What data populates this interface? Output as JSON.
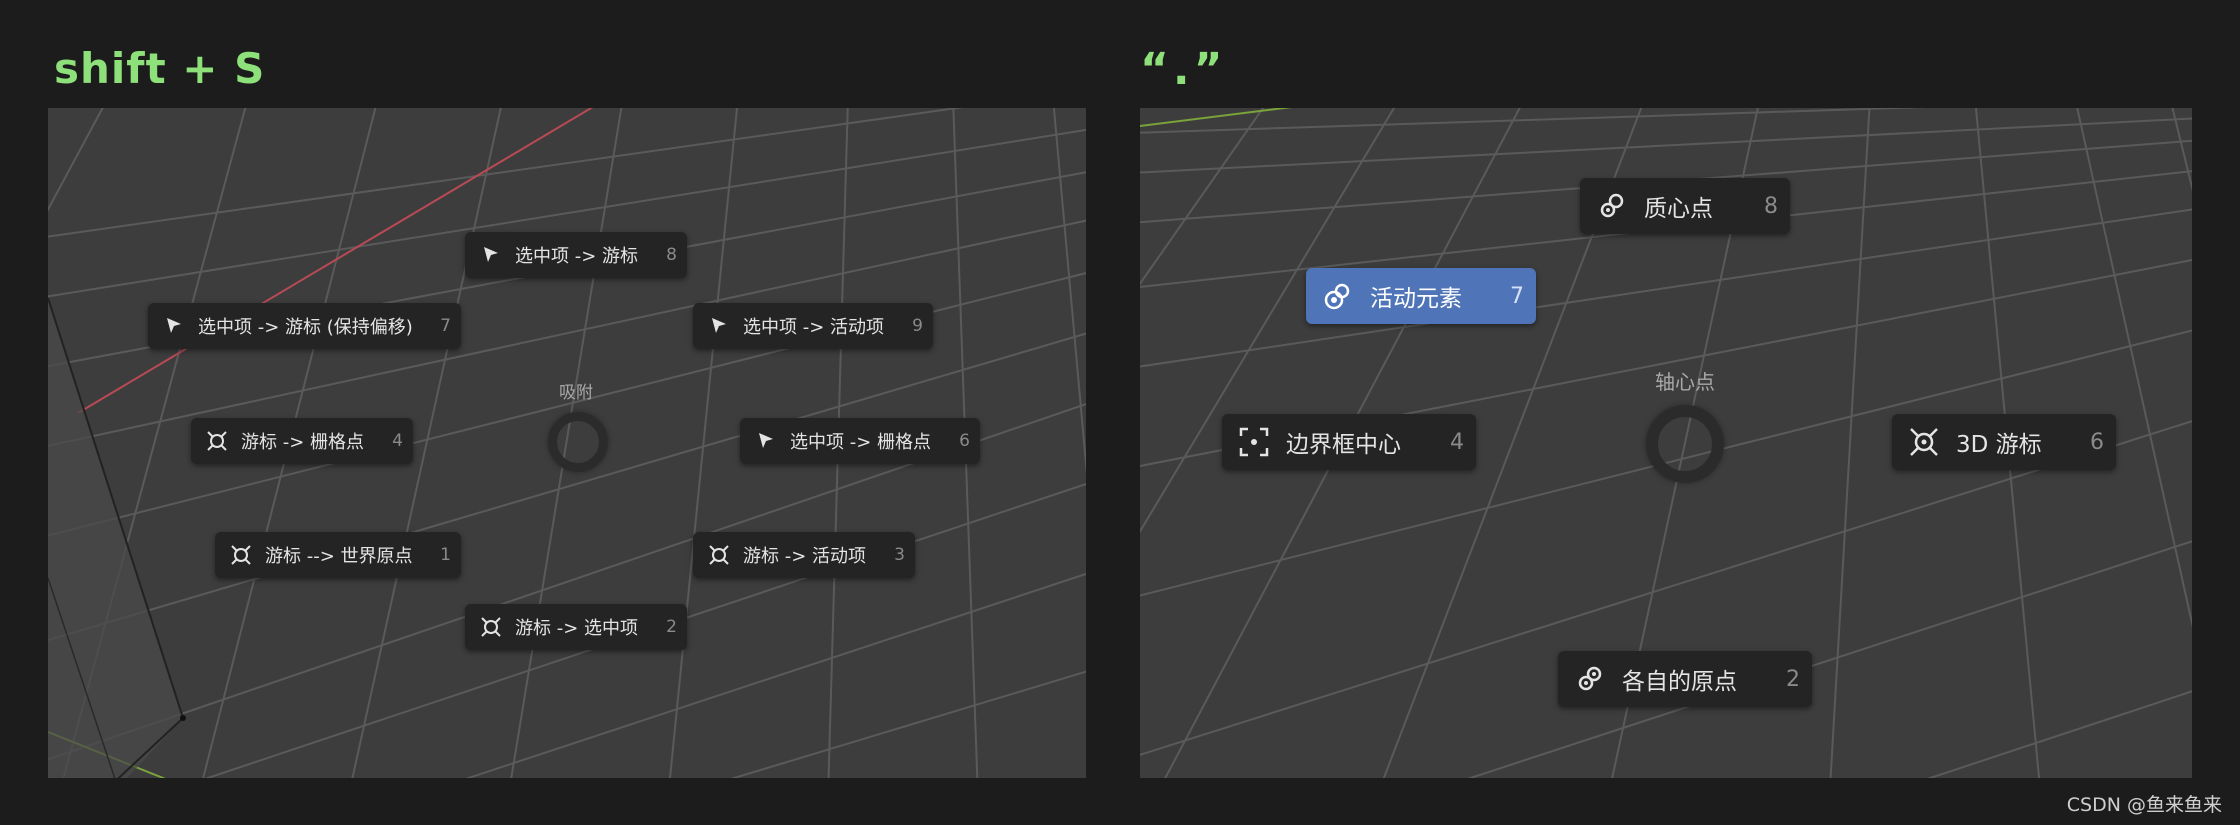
{
  "headings": {
    "left": "shift + S",
    "right": "“.”"
  },
  "left_panel": {
    "pie_title": "吸附",
    "items": [
      {
        "label": "选中项 -> 游标",
        "key": "8",
        "icon": "cursor-arrow-icon"
      },
      {
        "label": "选中项 -> 游标 (保持偏移)",
        "key": "7",
        "icon": "cursor-arrow-icon"
      },
      {
        "label": "选中项 -> 活动项",
        "key": "9",
        "icon": "cursor-arrow-icon"
      },
      {
        "label": "游标 -> 栅格点",
        "key": "4",
        "icon": "3d-cursor-icon"
      },
      {
        "label": "选中项 -> 栅格点",
        "key": "6",
        "icon": "cursor-arrow-icon"
      },
      {
        "label": "游标 --> 世界原点",
        "key": "1",
        "icon": "3d-cursor-icon"
      },
      {
        "label": "游标 -> 活动项",
        "key": "3",
        "icon": "3d-cursor-icon"
      },
      {
        "label": "游标 -> 选中项",
        "key": "2",
        "icon": "3d-cursor-icon"
      }
    ]
  },
  "right_panel": {
    "pie_title": "轴心点",
    "items": [
      {
        "label": "质心点",
        "key": "8",
        "icon": "median-point-icon",
        "active": false
      },
      {
        "label": "活动元素",
        "key": "7",
        "icon": "active-element-icon",
        "active": true
      },
      {
        "label": "边界框中心",
        "key": "4",
        "icon": "bounding-box-center-icon",
        "active": false
      },
      {
        "label": "3D 游标",
        "key": "6",
        "icon": "3d-cursor-icon",
        "active": false
      },
      {
        "label": "各自的原点",
        "key": "2",
        "icon": "individual-origins-icon",
        "active": false
      }
    ]
  },
  "colors": {
    "heading": "#8ee07a",
    "active_item": "#4f74b8",
    "x_axis": "#b84a55",
    "y_axis": "#7aa33a"
  },
  "watermark": "CSDN @鱼来鱼来"
}
